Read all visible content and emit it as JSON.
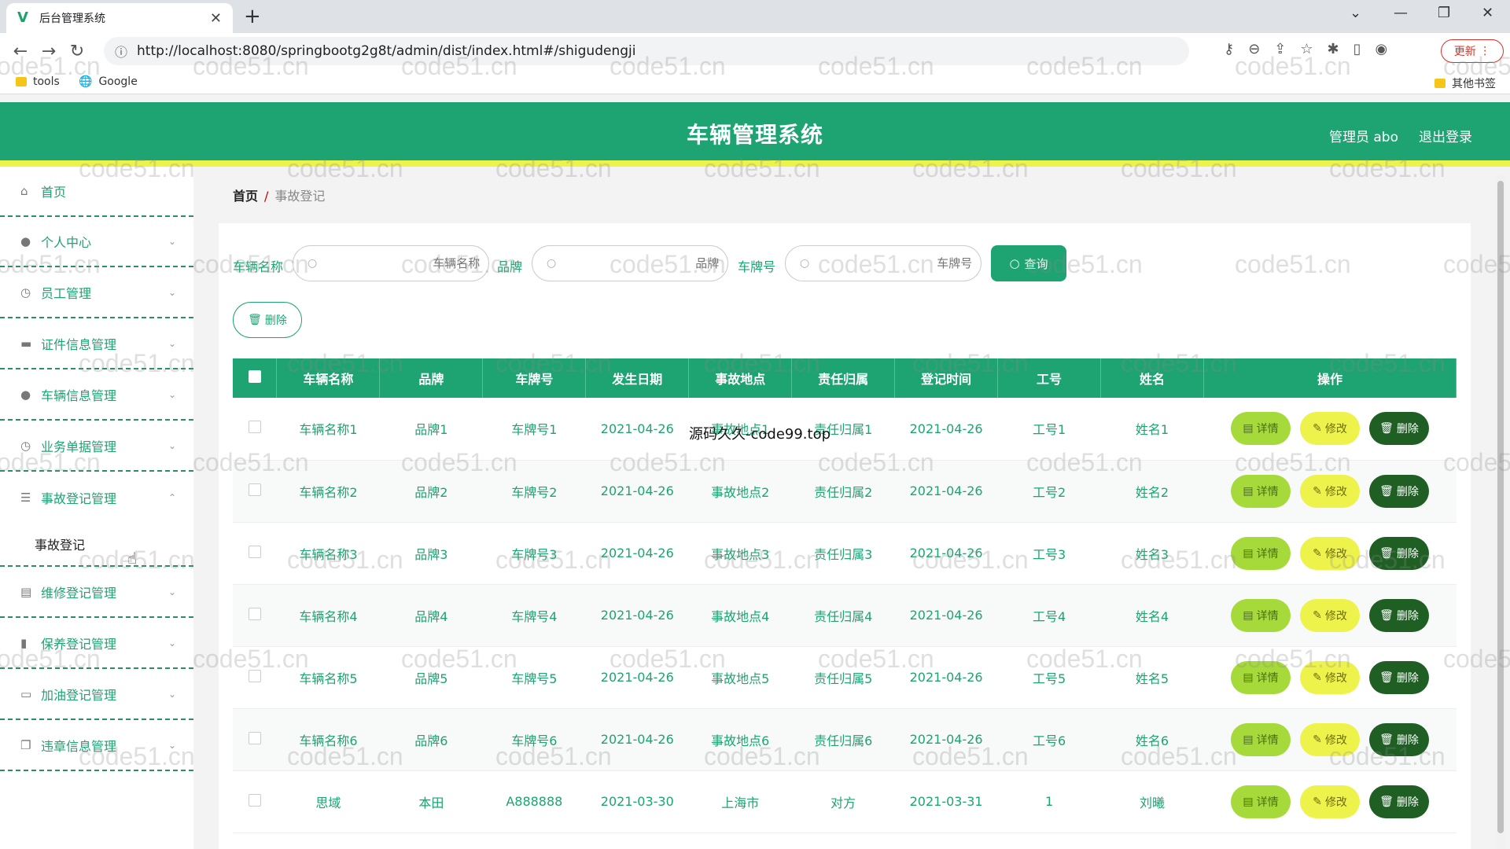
{
  "browser": {
    "tab_title": "后台管理系统",
    "url": "http://localhost:8080/springbootg2g8t/admin/dist/index.html#/shigudengji",
    "update_label": "更新",
    "bookmarks": [
      {
        "label": "tools"
      },
      {
        "label": "Google"
      }
    ],
    "other_bookmarks": "其他书签"
  },
  "header": {
    "title": "车辆管理系统",
    "user": "管理员 abo",
    "logout": "退出登录"
  },
  "sidebar": {
    "items": [
      {
        "label": "首页",
        "icon": "home-icon"
      },
      {
        "label": "个人中心",
        "icon": "user-icon"
      },
      {
        "label": "员工管理",
        "icon": "clock-icon"
      },
      {
        "label": "证件信息管理",
        "icon": "card-icon"
      },
      {
        "label": "车辆信息管理",
        "icon": "user-icon"
      },
      {
        "label": "业务单据管理",
        "icon": "clock-icon"
      },
      {
        "label": "事故登记管理",
        "icon": "sliders-icon"
      },
      {
        "label": "维修登记管理",
        "icon": "printer-icon"
      },
      {
        "label": "保养登记管理",
        "icon": "bar-chart-icon"
      },
      {
        "label": "加油登记管理",
        "icon": "chat-icon"
      },
      {
        "label": "违章信息管理",
        "icon": "copy-icon"
      }
    ],
    "subitem": "事故登记"
  },
  "breadcrumb": {
    "home": "首页",
    "separator": "/",
    "current": "事故登记"
  },
  "search": {
    "fields": [
      {
        "label": "车辆名称",
        "placeholder": "车辆名称"
      },
      {
        "label": "品牌",
        "placeholder": "品牌"
      },
      {
        "label": "车牌号",
        "placeholder": "车牌号"
      }
    ],
    "query_label": "查询",
    "delete_label": "删除"
  },
  "table": {
    "headers": [
      "车辆名称",
      "品牌",
      "车牌号",
      "发生日期",
      "事故地点",
      "责任归属",
      "登记时间",
      "工号",
      "姓名",
      "操作"
    ],
    "rows": [
      [
        "车辆名称1",
        "品牌1",
        "车牌号1",
        "2021-04-26",
        "事故地点1",
        "责任归属1",
        "2021-04-26",
        "工号1",
        "姓名1"
      ],
      [
        "车辆名称2",
        "品牌2",
        "车牌号2",
        "2021-04-26",
        "事故地点2",
        "责任归属2",
        "2021-04-26",
        "工号2",
        "姓名2"
      ],
      [
        "车辆名称3",
        "品牌3",
        "车牌号3",
        "2021-04-26",
        "事故地点3",
        "责任归属3",
        "2021-04-26",
        "工号3",
        "姓名3"
      ],
      [
        "车辆名称4",
        "品牌4",
        "车牌号4",
        "2021-04-26",
        "事故地点4",
        "责任归属4",
        "2021-04-26",
        "工号4",
        "姓名4"
      ],
      [
        "车辆名称5",
        "品牌5",
        "车牌号5",
        "2021-04-26",
        "事故地点5",
        "责任归属5",
        "2021-04-26",
        "工号5",
        "姓名5"
      ],
      [
        "车辆名称6",
        "品牌6",
        "车牌号6",
        "2021-04-26",
        "事故地点6",
        "责任归属6",
        "2021-04-26",
        "工号6",
        "姓名6"
      ],
      [
        "思域",
        "本田",
        "A888888",
        "2021-03-30",
        "上海市",
        "对方",
        "2021-03-31",
        "1",
        "刘曦"
      ]
    ],
    "actions": {
      "detail": "详情",
      "edit": "修改",
      "delete": "删除"
    }
  },
  "overlay_text": "源码久久-code99.top",
  "watermark": "code51.cn",
  "colors": {
    "primary": "#1ea372",
    "accent_yellow": "#eef34b",
    "detail": "#a6d93a",
    "danger_dark": "#1f5f24"
  }
}
